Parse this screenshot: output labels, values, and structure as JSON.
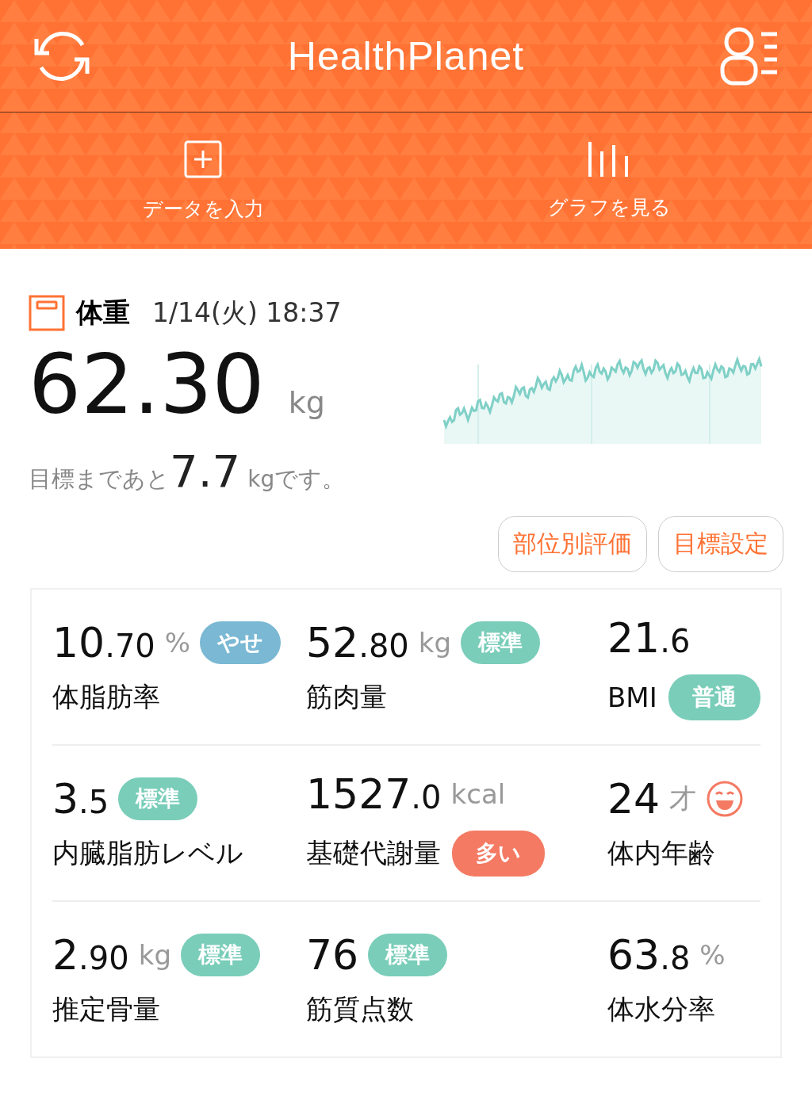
{
  "header": {
    "title": "HealthPlanet"
  },
  "actions": [
    {
      "label": "データを入力",
      "kind": "input"
    },
    {
      "label": "グラフを見る",
      "kind": "graph"
    }
  ],
  "weight": {
    "title": "体重",
    "datetime": "1/14(火) 18:37",
    "value": "62.30",
    "unit": "kg",
    "goal_prefix": "目標まであと",
    "goal_value": "7.7",
    "goal_unit": "kg",
    "goal_suffix": "です。"
  },
  "buttons": [
    {
      "label": "部位別評価"
    },
    {
      "label": "目標設定"
    }
  ],
  "metrics": [
    {
      "value": "10.70",
      "unit": "%",
      "label": "体脂肪率",
      "badge": "やせ",
      "color": "#7ab8d4",
      "badge_under_label": false,
      "kind": "badge"
    },
    {
      "value": "52.80",
      "unit": "kg",
      "label": "筋肉量",
      "badge": "標準",
      "color": "#79cdb9",
      "badge_under_label": false,
      "kind": "badge"
    },
    {
      "value": "21.6",
      "label": "BMI",
      "badge": "普通",
      "color": "#79cdb9",
      "badge_under_label": true,
      "kind": "badge"
    },
    {
      "value": "3.5",
      "label": "内臓脂肪レベル",
      "badge": "標準",
      "color": "#79cdb9",
      "badge_under_label": false,
      "kind": "badge"
    },
    {
      "value": "1527.0",
      "unit": "kcal",
      "label": "基礎代謝量",
      "badge": "多い",
      "color": "#f47a63",
      "badge_under_label": true,
      "kind": "badge"
    },
    {
      "value": "24",
      "unit": "才",
      "label": "体内年齢",
      "kind": "face"
    },
    {
      "value": "2.90",
      "unit": "kg",
      "label": "推定骨量",
      "badge": "標準",
      "color": "#79cdb9",
      "badge_under_label": false,
      "kind": "badge"
    },
    {
      "value": "76",
      "label": "筋質点数",
      "badge": "標準",
      "color": "#79cdb9",
      "badge_under_label": false,
      "kind": "badge"
    },
    {
      "value": "63.8",
      "unit": "%",
      "label": "体水分率",
      "kind": "plain"
    }
  ]
}
